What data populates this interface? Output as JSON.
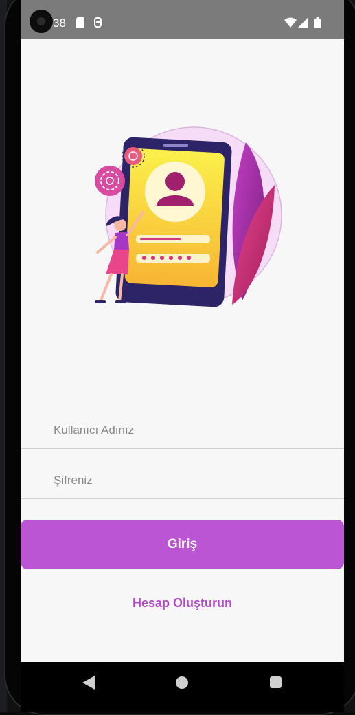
{
  "status_bar": {
    "time": "38",
    "left_icons": [
      "sd-card-icon",
      "usb-icon"
    ],
    "right_icons": [
      "wifi-icon",
      "signal-icon",
      "battery-icon"
    ]
  },
  "illustration": {
    "description_icon": "login-illustration"
  },
  "form": {
    "username": {
      "placeholder": "Kullanıcı Adınız",
      "value": ""
    },
    "password": {
      "placeholder": "Şifreniz",
      "value": ""
    }
  },
  "actions": {
    "login_label": "Giriş",
    "register_label": "Hesap Oluşturun"
  },
  "colors": {
    "accent": "#bb55d4",
    "link": "#b24ac8",
    "status_bar": "#7b7b7b",
    "background": "#f7f7f7"
  },
  "nav_bar": {
    "buttons": [
      "back-icon",
      "home-icon",
      "recents-icon"
    ]
  }
}
